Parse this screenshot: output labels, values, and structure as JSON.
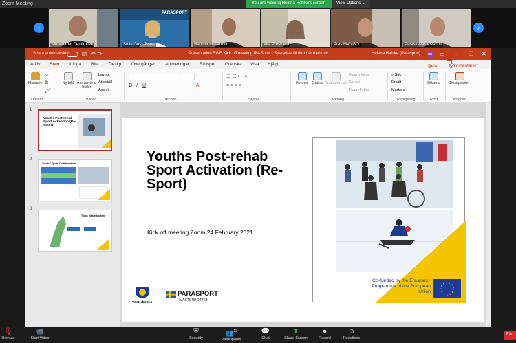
{
  "zoom": {
    "window_title": "Zoom Meeting",
    "share_banner": "You are viewing Helena Hehlke's screen",
    "view_options": "View Options ⌄",
    "participants": [
      {
        "name": "Muhammet Demirbilek",
        "bg": "#c9c2b5"
      },
      {
        "name": "Sofie Gustafsson",
        "bg": "#2b6fa6"
      },
      {
        "name": "vladimir mrdakovic",
        "bg": "#bfae9a"
      },
      {
        "name": "Vita President",
        "bg": "#d7d0c2"
      },
      {
        "name": "Pres MVNGO",
        "bg": "#8a5f4a"
      },
      {
        "name": "Paraskevas Alvanos",
        "bg": "#c8c3bb"
      }
    ],
    "tile_badge": "PARASPORT",
    "toolbar": {
      "unmute": "Unmute",
      "start_video": "Start Video",
      "security": "Security",
      "participants": "Participants",
      "participants_count": "13",
      "chat": "Chat",
      "share_screen": "Share Screen",
      "record": "Record",
      "reactions": "Reactions",
      "end": "End"
    }
  },
  "ppt": {
    "autosave": "Spara automatiskt",
    "doc_title": "Presentation SWE Kick off meeting Re-Sport  -  Sparades till den här datorn  ▾",
    "user": "Helena Hehlke (Parasport)",
    "user_initials": "HH",
    "tabs": [
      "Arkiv",
      "Start",
      "Infoga",
      "Rita",
      "Design",
      "Övergångar",
      "Animeringar",
      "Bildspel",
      "Granska",
      "Visa",
      "Hjälp"
    ],
    "share": "Dela",
    "comments": "Kommentarer",
    "ribbon": {
      "paste": "Klistra in",
      "clipboard": "Urklipp",
      "new_slide": "Ny bild",
      "reuse": "Återanvänd bilder",
      "layout": "Layout",
      "reset": "Återställ",
      "section": "Avsnitt",
      "slides": "Bilder",
      "font": "Tecken",
      "paragraph": "Stycke",
      "shapes": "Former",
      "arrange": "Ordna",
      "quickstyles": "Snabbformat",
      "fill": "Figurfyllning",
      "outline": "Kontur",
      "effects": "Figureffekter",
      "drawing": "Ritning",
      "find": "Sök",
      "replace": "Ersätt",
      "select": "Markera",
      "editing": "Redigering",
      "dictate": "Diktera",
      "voice": "Röst",
      "designer": "Designidéer",
      "designer_group": "Designer"
    },
    "slide_numbers": [
      "1",
      "2",
      "3"
    ],
    "thumb1_title": "Youths Post-rehab Sport Activation (Re-Sport)",
    "thumb2_title": "Youth3 Sport Collaboration",
    "thumb3_title": "Team Västerbotten",
    "slide": {
      "title": "Youths Post-rehab Sport Activation (Re-Sport)",
      "subtitle": "Kick off meeting Zoom 24 February 2021",
      "logo1_text": "Västerbotten",
      "logo2_main": "PARASPORT",
      "logo2_sub": "/VÄSTERBOTTEN",
      "funding": "Co-funded by the Erasmus+ Programme of the European Union"
    }
  },
  "colors": {
    "ppt_accent": "#c43e1c",
    "yellow": "#f5c400",
    "zoom_blue": "#2d8cff",
    "zoom_green": "#2ea44f"
  }
}
